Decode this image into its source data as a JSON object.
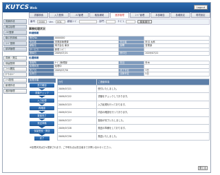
{
  "app": {
    "logo": "KUTCS",
    "logo_sub": "Web",
    "logout": "Logout"
  },
  "tabs": [
    "書類検索",
    "入力登録",
    "ﾉﾙﾏ管理",
    "取扱補助",
    "進捗管理",
    "ｺｰﾄﾞ管理",
    "本部報告",
    "各種設定",
    "環境設定"
  ],
  "active_tab": 4,
  "sidebar": {
    "group1": [
      "見積作成",
      "発注処理",
      "ﾉﾙﾏ登録",
      "取引先検索",
      "ｺｰﾄﾞ登録",
      "請求管理"
    ],
    "group2": [
      "見積・発注",
      "保留登録",
      "ﾌｧｲﾙ閲覧",
      "ﾀﾞｳﾝﾛｰﾄﾞ",
      "ﾒｰﾙ配信",
      "新規作成",
      "進捗管理"
    ]
  },
  "filter": {
    "l1": "番号",
    "v1": "0000",
    "l2": "Ver.",
    "v2": "V01",
    "l3": "顧客ｺｰﾄﾞ",
    "v3": "",
    "l4": "部門",
    "v4": "",
    "l5": "ｻｰﾋﾞｽ",
    "v5": "",
    "btn": "検索実行"
  },
  "page_title": "事務処理状況",
  "section1": {
    "title": "申請情報",
    "rows": [
      [
        "受付No",
        "0000000",
        "",
        ""
      ],
      [
        "申請者",
        "営業部管理課",
        "担当者",
        "担当 太郎"
      ],
      [
        "顧客名",
        "株式会社 東京",
        "部署",
        "営業部"
      ],
      [
        "サービス",
        "新規 ｺﾝﾋﾞﾆ",
        "",
        ""
      ],
      [
        "登録日",
        "2009/07/21",
        "受付日",
        "2009/07/22"
      ]
    ]
  },
  "section2": {
    "title": "処理情報",
    "rows": [
      [
        "事務所",
        "ｻｰﾋﾞｽ管理部",
        "担当",
        "鈴木"
      ],
      [
        "処理状況",
        "処理中",
        "",
        ""
      ],
      [
        "完了日",
        "2009/07/30",
        "完了予定",
        "3日"
      ],
      [
        "出荷日",
        "",
        "出荷予定",
        "5日"
      ]
    ]
  },
  "flow": {
    "header": "処理手順",
    "steps": [
      "受付確認",
      "書類チェック",
      "入力処理",
      "再確認",
      "登録完了",
      "発送準備",
      "保留登録・発送"
    ],
    "end": "完了"
  },
  "history": {
    "headers": [
      "日付",
      "ご連絡事項"
    ],
    "rows": [
      [
        "2009/07/21",
        "受付いたしました。"
      ],
      [
        "2009/07/22",
        "書類をチェックしております。"
      ],
      [
        "2009/07/23",
        "入力処理を行っております。"
      ],
      [
        "2009/07/24",
        "内容の確認を行っております。"
      ],
      [
        "2009/07/27",
        "登録が完了いたしました。"
      ],
      [
        "2009/07/28",
        "発送の準備をしております。"
      ],
      [
        "2009/07/30",
        "発送いたしました。"
      ]
    ]
  },
  "note": "※処理状況は日々更新されます。ご不明な点は担当者までお問い合わせください。",
  "close_btn": "閉じる"
}
